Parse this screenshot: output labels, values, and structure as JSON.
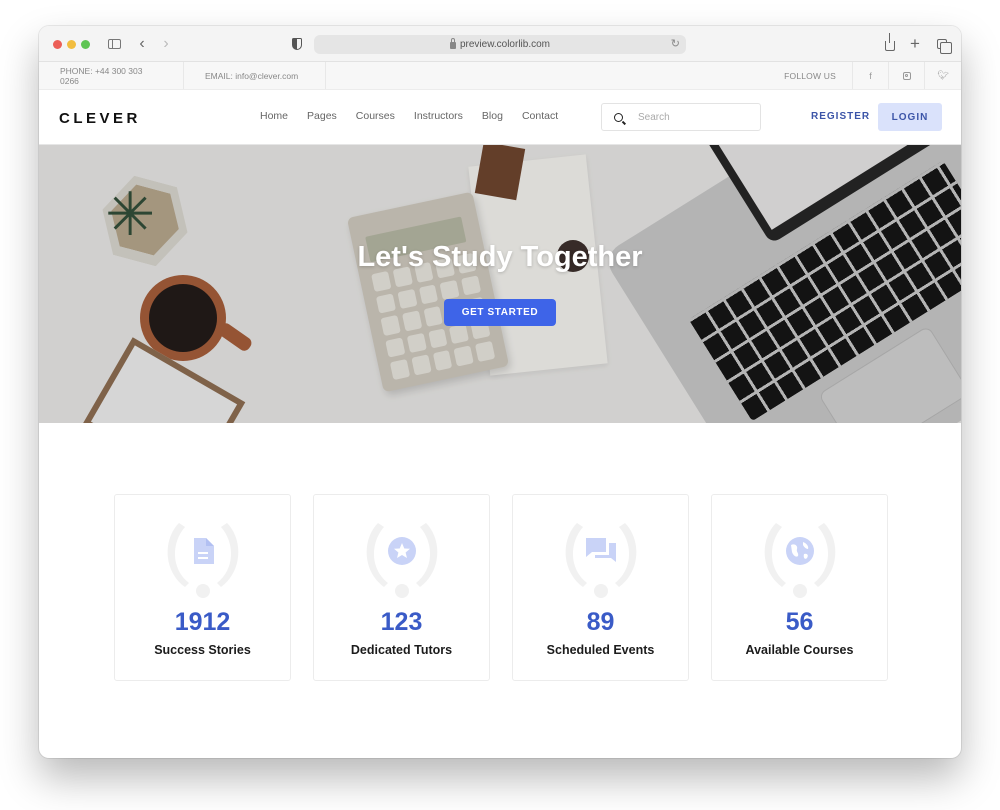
{
  "browser": {
    "url": "preview.colorlib.com"
  },
  "topbar": {
    "phone": "PHONE: +44 300 303 0266",
    "email": "EMAIL: info@clever.com",
    "follow_label": "FOLLOW US",
    "socials": [
      "facebook",
      "instagram",
      "twitter"
    ]
  },
  "navbar": {
    "logo": "CLEVER",
    "links": [
      "Home",
      "Pages",
      "Courses",
      "Instructors",
      "Blog",
      "Contact"
    ],
    "search_placeholder": "Search",
    "register_label": "REGISTER",
    "login_label": "LOGIN"
  },
  "hero": {
    "title": "Let's Study Together",
    "cta_label": "GET STARTED"
  },
  "stats": [
    {
      "icon": "document-icon",
      "number": "1912",
      "label": "Success Stories"
    },
    {
      "icon": "star-icon",
      "number": "123",
      "label": "Dedicated Tutors"
    },
    {
      "icon": "chat-icon",
      "number": "89",
      "label": "Scheduled Events"
    },
    {
      "icon": "globe-icon",
      "number": "56",
      "label": "Available Courses"
    }
  ],
  "colors": {
    "accent": "#3e64e8",
    "stat_number": "#3a5bc7",
    "login_bg": "#dae2fb",
    "icon_tint": "#c9d3f7"
  }
}
